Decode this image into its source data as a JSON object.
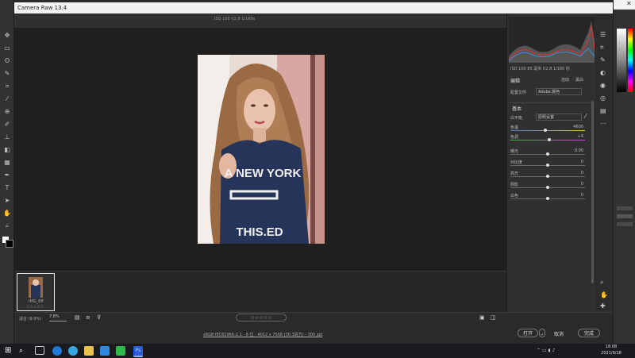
{
  "window": {
    "title": "Camera Raw 13.4",
    "file_info": "ISO 100  f/2.8  1/160s",
    "status_line": "sRGB IEC61966-2.1 - 8 位 - 4012 x 7568 (30.3百万) - 300 ppi"
  },
  "panel": {
    "camera_info": "ISO 100   85 毫米   f/2.8   1/160 秒",
    "edit_label": "编辑",
    "auto_label": "自动",
    "bw_label": "黑白",
    "profile_label": "配置文件",
    "profile_value": "Adobe 颜色",
    "section_title": "基本",
    "wb_label": "白平衡",
    "wb_value": "原照设置",
    "sliders": [
      {
        "label": "色温",
        "value": "4600",
        "pos": 0.47
      },
      {
        "label": "色调",
        "value": "+4",
        "pos": 0.52
      },
      {
        "label": "曝光",
        "value": "0.00",
        "pos": 0.5
      },
      {
        "label": "对比度",
        "value": "0",
        "pos": 0.5
      },
      {
        "label": "高光",
        "value": "0",
        "pos": 0.5
      },
      {
        "label": "阴影",
        "value": "0",
        "pos": 0.5
      },
      {
        "label": "白色",
        "value": "0",
        "pos": 0.5
      }
    ]
  },
  "filmstrip": {
    "thumb_label": "IMG_8ff",
    "stars": "☆☆☆☆☆"
  },
  "bottom": {
    "zoom_label": "适合 (9.9%)",
    "zoom_value": "7.8%",
    "rating_stars": "☆☆☆☆☆",
    "open_button": "打开",
    "cancel_button": "取消",
    "done_button": "完成"
  },
  "photo": {
    "shirt_text_1": "A NEW YORK",
    "shirt_text_2": "THIS.ED"
  },
  "taskbar": {
    "time": "18:08",
    "date": "2021/9/18"
  },
  "colors": {
    "accent_red": "#e03030",
    "histogram_blue": "#3a8fd8",
    "photoshop_blue": "#2b5bd8"
  }
}
